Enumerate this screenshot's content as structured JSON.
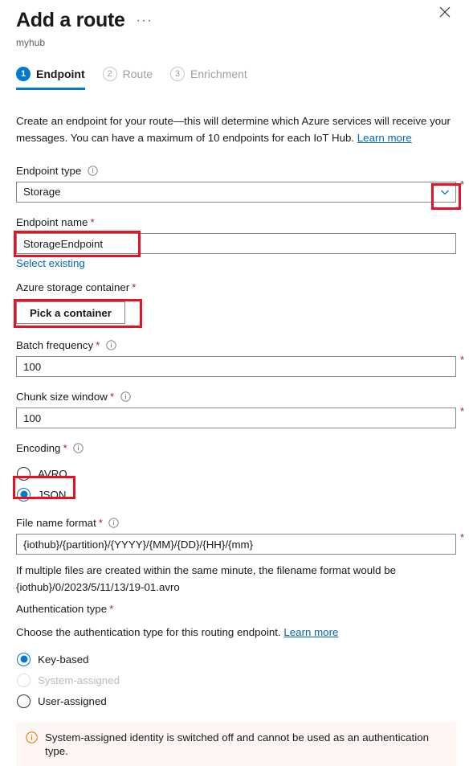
{
  "header": {
    "title": "Add a route",
    "more_label": "···",
    "subtitle": "myhub",
    "close_icon": "close-icon"
  },
  "tabs": [
    {
      "number": "1",
      "label": "Endpoint",
      "state": "active"
    },
    {
      "number": "2",
      "label": "Route",
      "state": "inactive"
    },
    {
      "number": "3",
      "label": "Enrichment",
      "state": "inactive"
    }
  ],
  "description": {
    "text": "Create an endpoint for your route—this will determine which Azure services will receive your messages. You can have a maximum of 10 endpoints for each IoT Hub. ",
    "link": "Learn more"
  },
  "endpoint_type": {
    "label": "Endpoint type",
    "value": "Storage",
    "required_star": "*",
    "info_icon": "info-icon",
    "chevron_icon": "chevron-down-icon"
  },
  "endpoint_name": {
    "label": "Endpoint name",
    "required": "*",
    "value": "StorageEndpoint",
    "select_existing": "Select existing"
  },
  "storage_container": {
    "label": "Azure storage container",
    "required": "*",
    "button_label": "Pick a container"
  },
  "batch_frequency": {
    "label": "Batch frequency",
    "required": "*",
    "value": "100",
    "trailing_star": "*",
    "info_icon": "info-icon"
  },
  "chunk_size": {
    "label": "Chunk size window",
    "required": "*",
    "value": "100",
    "trailing_star": "*",
    "info_icon": "info-icon"
  },
  "encoding": {
    "label": "Encoding",
    "required": "*",
    "info_icon": "info-icon",
    "options": [
      {
        "label": "AVRO",
        "selected": false
      },
      {
        "label": "JSON",
        "selected": true
      }
    ]
  },
  "file_name_format": {
    "label": "File name format",
    "required": "*",
    "info_icon": "info-icon",
    "value": "{iothub}/{partition}/{YYYY}/{MM}/{DD}/{HH}/{mm}",
    "trailing_star": "*",
    "help_text": "If multiple files are created within the same minute, the filename format would be {iothub}/0/2023/5/11/13/19-01.avro"
  },
  "authentication": {
    "label": "Authentication type",
    "required": "*",
    "description": "Choose the authentication type for this routing endpoint. ",
    "link": "Learn more",
    "options": [
      {
        "label": "Key-based",
        "selected": true,
        "disabled": false
      },
      {
        "label": "System-assigned",
        "selected": false,
        "disabled": true
      },
      {
        "label": "User-assigned",
        "selected": false,
        "disabled": false
      }
    ]
  },
  "banner": {
    "icon": "info-circle-icon",
    "text": "System-assigned identity is switched off and cannot be used as an authentication type."
  },
  "colors": {
    "accent": "#0078d4",
    "link": "#0067b8",
    "required": "#a4262c",
    "highlight": "#e81123",
    "banner_bg": "#fdf6f3",
    "banner_icon": "#d97706"
  }
}
